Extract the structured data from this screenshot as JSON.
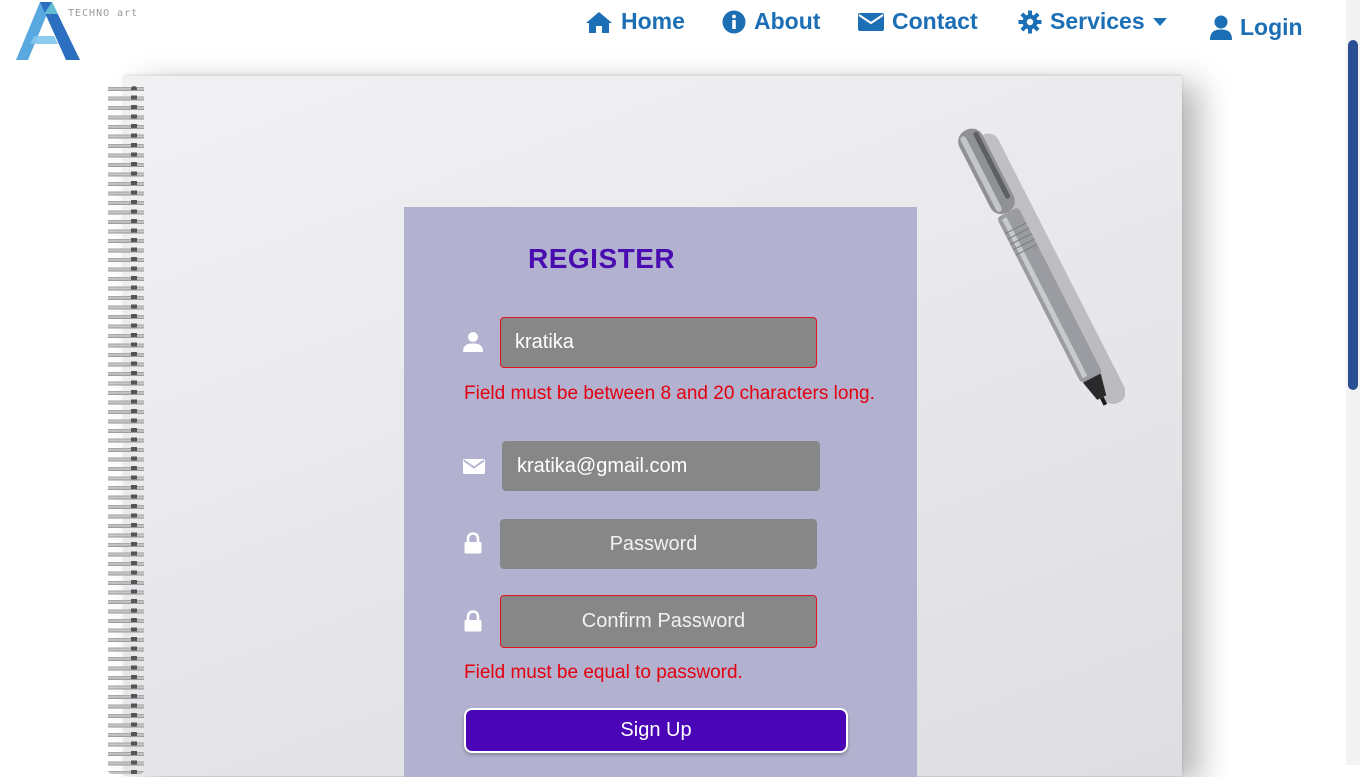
{
  "header": {
    "logo_text": "TECHNO art",
    "nav": {
      "home": "Home",
      "about": "About",
      "contact": "Contact",
      "services": "Services",
      "login": "Login"
    }
  },
  "register": {
    "title": "REGISTER",
    "username": {
      "value": "kratika",
      "error": "Field must be between 8 and 20 characters long."
    },
    "email": {
      "value": "kratika@gmail.com"
    },
    "password": {
      "placeholder": "Password"
    },
    "confirm_password": {
      "placeholder": "Confirm Password",
      "error": "Field must be equal to password."
    },
    "signup_label": "Sign Up"
  },
  "icons": {
    "home": "home-icon",
    "about": "info-circle-icon",
    "contact": "envelope-icon",
    "services": "gear-icon",
    "services_caret": "caret-down-icon",
    "login": "user-icon",
    "username": "user-icon",
    "email": "envelope-icon",
    "password": "lock-icon",
    "confirm_password": "lock-icon"
  },
  "colors": {
    "nav_link": "#1c6fb5",
    "title": "#4a0bb0",
    "card_bg": "#b2b1cf",
    "field_bg": "#878787",
    "error": "#e3000f",
    "button_bg": "#4a05b7",
    "scrollbar_thumb": "#2b4f93"
  }
}
